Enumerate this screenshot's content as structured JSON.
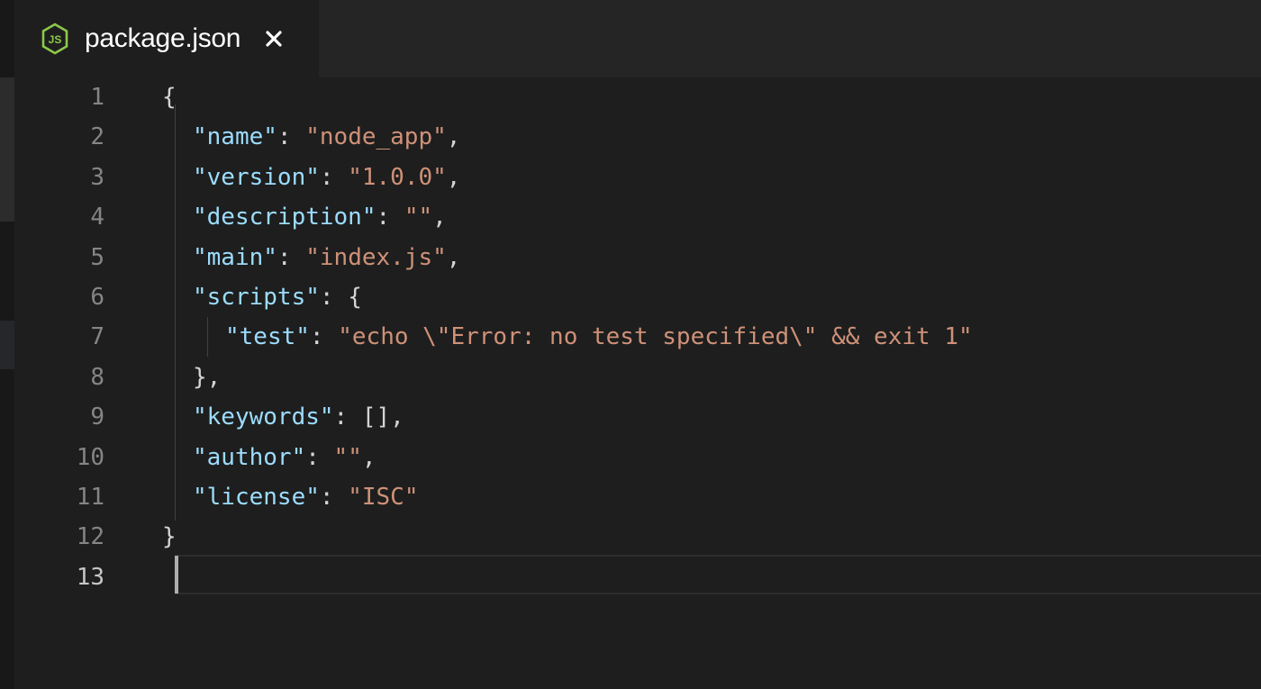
{
  "tab": {
    "title": "package.json",
    "icon": "nodejs-icon",
    "close_icon": "close-icon"
  },
  "editor": {
    "line_numbers": [
      "1",
      "2",
      "3",
      "4",
      "5",
      "6",
      "7",
      "8",
      "9",
      "10",
      "11",
      "12",
      "13"
    ],
    "active_line": 13,
    "lines": [
      "{",
      "\"name\": \"node_app\",",
      "\"version\": \"1.0.0\",",
      "\"description\": \"\",",
      "\"main\": \"index.js\",",
      "\"scripts\": {",
      "\"test\": \"echo \\\"Error: no test specified\\\" && exit 1\"",
      "},",
      "\"keywords\": [],",
      "\"author\": \"\",",
      "\"license\": \"ISC\"",
      "}",
      ""
    ],
    "tokens": {
      "l1_brace": "{",
      "l2_key": "\"name\"",
      "l2_sep": ": ",
      "l2_val": "\"node_app\"",
      "l2_end": ",",
      "l3_key": "\"version\"",
      "l3_sep": ": ",
      "l3_val": "\"1.0.0\"",
      "l3_end": ",",
      "l4_key": "\"description\"",
      "l4_sep": ": ",
      "l4_val": "\"\"",
      "l4_end": ",",
      "l5_key": "\"main\"",
      "l5_sep": ": ",
      "l5_val": "\"index.js\"",
      "l5_end": ",",
      "l6_key": "\"scripts\"",
      "l6_sep": ": ",
      "l6_open": "{",
      "l7_key": "\"test\"",
      "l7_sep": ": ",
      "l7_val": "\"echo \\\"Error: no test specified\\\" && exit 1\"",
      "l8_close": "},",
      "l9_key": "\"keywords\"",
      "l9_sep": ": ",
      "l9_val": "[],",
      "l10_key": "\"author\"",
      "l10_sep": ": ",
      "l10_val": "\"\"",
      "l10_end": ",",
      "l11_key": "\"license\"",
      "l11_sep": ": ",
      "l11_val": "\"ISC\"",
      "l12_brace": "}"
    }
  },
  "colors": {
    "background": "#1e1e1e",
    "tabbar": "#252526",
    "key": "#9cdcfe",
    "string": "#ce9178",
    "punctuation": "#d4d4d4",
    "line_number": "#858585",
    "node_green": "#8cc84b"
  }
}
